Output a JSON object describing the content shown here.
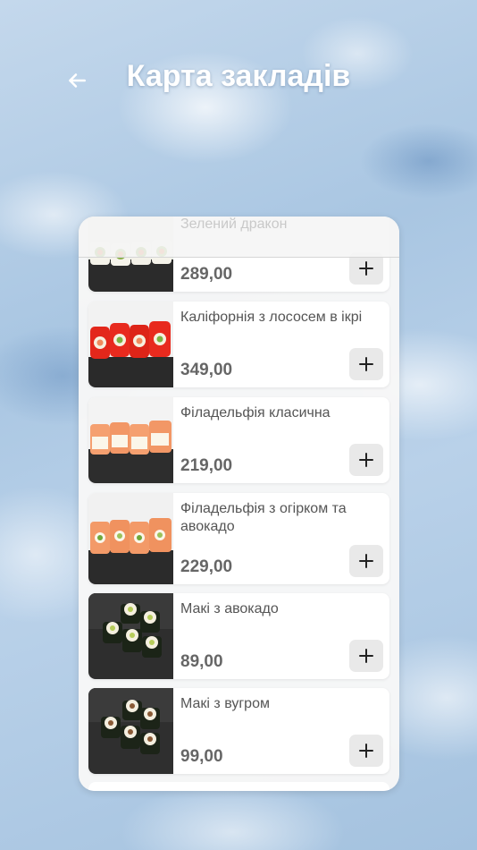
{
  "header": {
    "title": "Карта закладів",
    "back_icon": "arrow-left-icon"
  },
  "menu": {
    "top_partial": {
      "name": "Зелений дракон",
      "price": "289,00"
    },
    "items": [
      {
        "name": "Каліфорнія з лососем в ікрі",
        "price": "349,00",
        "thumb": "red-roe-roll"
      },
      {
        "name": "Філадельфія класична",
        "price": "219,00",
        "thumb": "salmon-roll"
      },
      {
        "name": "Філадельфія з огірком та авокадо",
        "price": "229,00",
        "thumb": "salmon-avocado-roll"
      },
      {
        "name": "Макі з авокадо",
        "price": "89,00",
        "thumb": "maki-avocado"
      },
      {
        "name": "Макі з вугром",
        "price": "99,00",
        "thumb": "maki-eel"
      }
    ],
    "add_icon": "plus-icon"
  },
  "colors": {
    "panel_bg": "#f7f7f7",
    "card_bg": "#ffffff",
    "text": "#555555",
    "price": "#666666",
    "button_bg": "#e9e9e9"
  }
}
